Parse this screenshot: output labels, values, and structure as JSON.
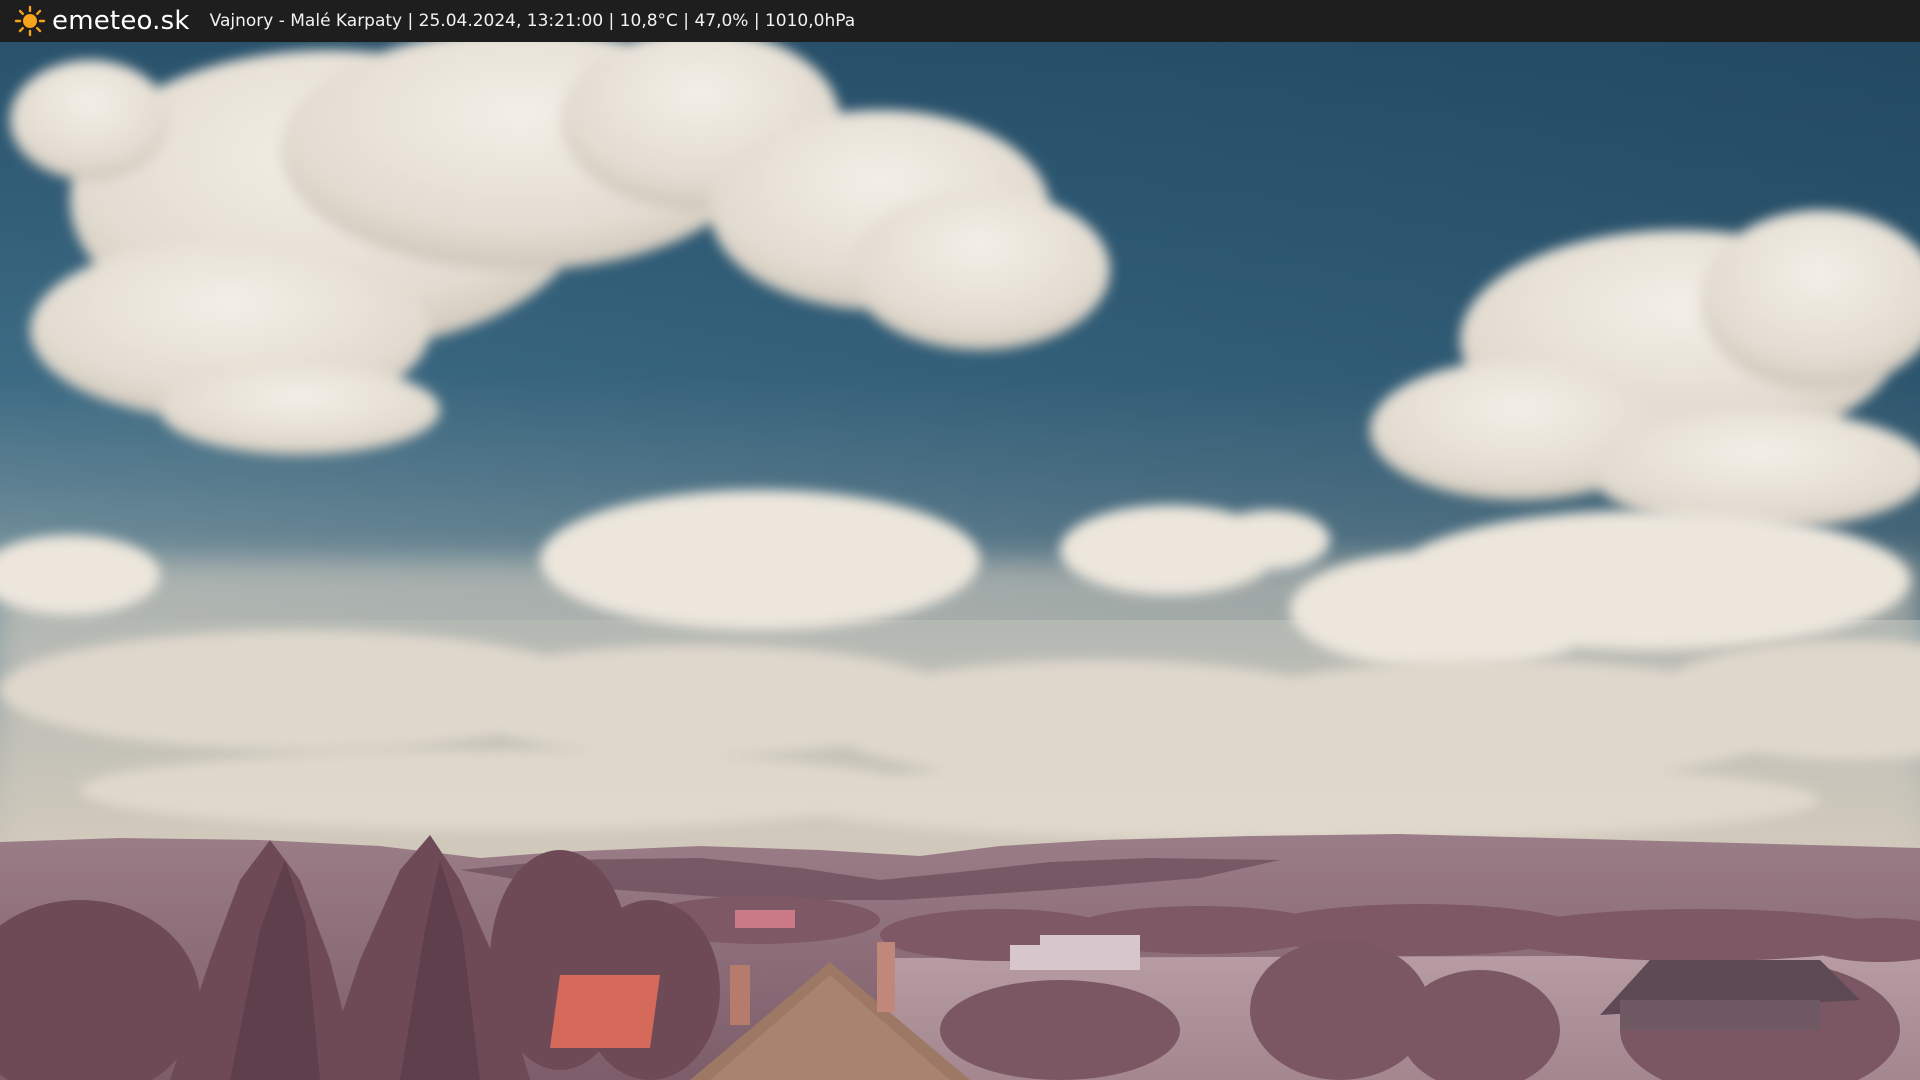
{
  "header": {
    "brand": "emeteo.sk",
    "brand_icon": "sun-icon",
    "status_line": "Vajnory - Malé Karpaty | 25.04.2024, 13:21:00 | 10,8°C | 47,0% | 1010,0hPa"
  },
  "colors": {
    "bar_background": "#1e1e1e",
    "sun_color": "#f5a41b",
    "sky_top": "#2d5a76",
    "sky_bottom": "#c8c2b5",
    "hills": "#8a6a77",
    "foliage": "#7a5460"
  }
}
